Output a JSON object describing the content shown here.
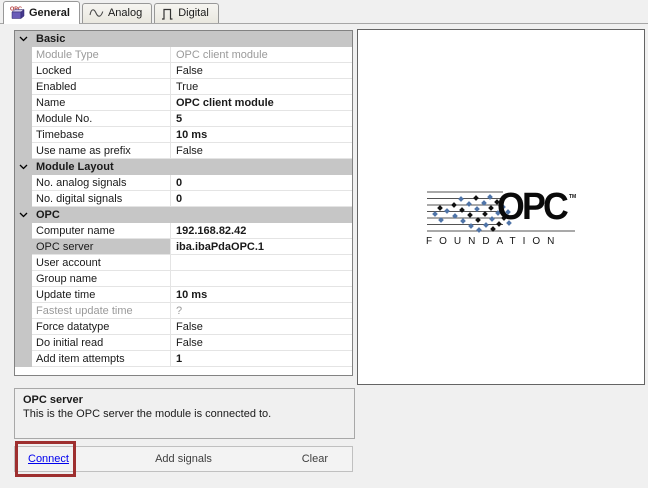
{
  "tabs": [
    {
      "label": "General",
      "active": true
    },
    {
      "label": "Analog",
      "active": false
    },
    {
      "label": "Digital",
      "active": false
    }
  ],
  "property_grid": {
    "rows": [
      {
        "kind": "category",
        "label": "Basic"
      },
      {
        "kind": "property",
        "label": "Module Type",
        "value": "OPC client module",
        "disabled": true
      },
      {
        "kind": "property",
        "label": "Locked",
        "value": "False"
      },
      {
        "kind": "property",
        "label": "Enabled",
        "value": "True"
      },
      {
        "kind": "property",
        "label": "Name",
        "value": "OPC client module",
        "bold": true
      },
      {
        "kind": "property",
        "label": "Module No.",
        "value": "5",
        "bold": true
      },
      {
        "kind": "property",
        "label": "Timebase",
        "value": "10 ms",
        "bold": true
      },
      {
        "kind": "property",
        "label": "Use name as prefix",
        "value": "False"
      },
      {
        "kind": "category",
        "label": "Module Layout"
      },
      {
        "kind": "property",
        "label": "No. analog signals",
        "value": "0",
        "bold": true
      },
      {
        "kind": "property",
        "label": "No. digital signals",
        "value": "0",
        "bold": true
      },
      {
        "kind": "category",
        "label": "OPC"
      },
      {
        "kind": "property",
        "label": "Computer name",
        "value": "192.168.82.42",
        "bold": true
      },
      {
        "kind": "property",
        "label": "OPC server",
        "value": "iba.ibaPdaOPC.1",
        "bold": true,
        "selected": true
      },
      {
        "kind": "property",
        "label": "User account",
        "value": ""
      },
      {
        "kind": "property",
        "label": "Group name",
        "value": ""
      },
      {
        "kind": "property",
        "label": "Update time",
        "value": "10 ms",
        "bold": true
      },
      {
        "kind": "property",
        "label": "Fastest update time",
        "value": "?",
        "disabled": true
      },
      {
        "kind": "property",
        "label": "Force datatype",
        "value": "False"
      },
      {
        "kind": "property",
        "label": "Do initial read",
        "value": "False"
      },
      {
        "kind": "property",
        "label": "Add item attempts",
        "value": "1",
        "bold": true
      }
    ]
  },
  "logo": {
    "title": "OPC",
    "trademark": "TM",
    "subtitle": "FOUNDATION",
    "blue": "#4f74a8"
  },
  "description_panel": {
    "title": "OPC server",
    "text": "This is the OPC server the module is connected to."
  },
  "action_bar": {
    "connect": "Connect",
    "add_signals": "Add signals",
    "clear": "Clear"
  },
  "colors": {
    "annotation_red": "#9e2f2f",
    "link_blue": "#0000ee",
    "category_gray": "#c6c6c6",
    "panel_bg": "#f0f0f0"
  }
}
